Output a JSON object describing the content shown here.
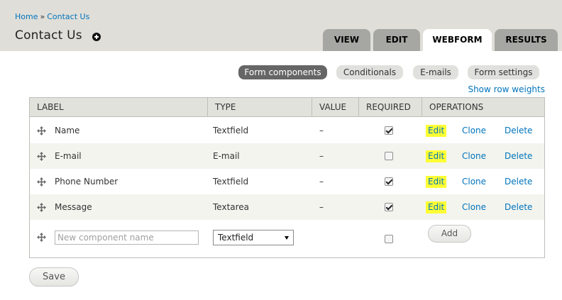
{
  "breadcrumb": {
    "home": "Home",
    "separator": "»",
    "current": "Contact Us"
  },
  "page_title": "Contact Us",
  "tabs": [
    {
      "label": "VIEW",
      "active": false
    },
    {
      "label": "EDIT",
      "active": false
    },
    {
      "label": "WEBFORM",
      "active": true
    },
    {
      "label": "RESULTS",
      "active": false
    }
  ],
  "secondary_tabs": [
    {
      "label": "Form components",
      "active": true
    },
    {
      "label": "Conditionals",
      "active": false
    },
    {
      "label": "E-mails",
      "active": false
    },
    {
      "label": "Form settings",
      "active": false
    }
  ],
  "show_row_weights": "Show row weights",
  "table": {
    "headers": [
      "LABEL",
      "TYPE",
      "VALUE",
      "REQUIRED",
      "OPERATIONS"
    ],
    "rows": [
      {
        "label": "Name",
        "type": "Textfield",
        "value": "–",
        "required": true,
        "edit": "Edit",
        "clone": "Clone",
        "delete": "Delete"
      },
      {
        "label": "E-mail",
        "type": "E-mail",
        "value": "–",
        "required": false,
        "edit": "Edit",
        "clone": "Clone",
        "delete": "Delete"
      },
      {
        "label": "Phone Number",
        "type": "Textfield",
        "value": "–",
        "required": true,
        "edit": "Edit",
        "clone": "Clone",
        "delete": "Delete"
      },
      {
        "label": "Message",
        "type": "Textarea",
        "value": "–",
        "required": true,
        "edit": "Edit",
        "clone": "Clone",
        "delete": "Delete"
      }
    ],
    "new_component": {
      "placeholder": "New component name",
      "value": "",
      "type_selected": "Textfield",
      "required": false,
      "add_label": "Add"
    }
  },
  "save_label": "Save",
  "colors": {
    "link": "#0074bd",
    "highlight": "#ffff33",
    "header_bg": "#e0ded8",
    "tab_bg": "#a6a7a2"
  },
  "icons": {
    "shortcut": "plus-circle-icon",
    "drag": "move-arrows-icon",
    "select": "triangle-down-icon"
  }
}
